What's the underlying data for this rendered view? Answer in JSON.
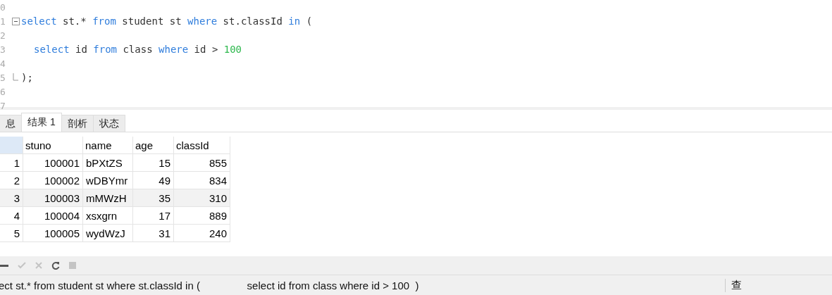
{
  "editor": {
    "lines": [
      {
        "number": "0",
        "kind": "plain"
      },
      {
        "number": "1",
        "kind": "fold_start",
        "tokens": [
          {
            "kind": "keyword",
            "text": "select"
          },
          {
            "kind": "plain",
            "text": " st.* "
          },
          {
            "kind": "keyword",
            "text": "from"
          },
          {
            "kind": "plain",
            "text": " student st "
          },
          {
            "kind": "keyword",
            "text": "where"
          },
          {
            "kind": "plain",
            "text": " st.classId "
          },
          {
            "kind": "keyword",
            "text": "in"
          },
          {
            "kind": "plain",
            "text": " ("
          }
        ]
      },
      {
        "number": "2",
        "kind": "plain"
      },
      {
        "number": "3",
        "kind": "indented",
        "tokens": [
          {
            "kind": "keyword",
            "text": "select"
          },
          {
            "kind": "plain",
            "text": " id "
          },
          {
            "kind": "keyword",
            "text": "from"
          },
          {
            "kind": "plain",
            "text": " class "
          },
          {
            "kind": "keyword",
            "text": "where"
          },
          {
            "kind": "plain",
            "text": " id > "
          },
          {
            "kind": "number",
            "text": "100"
          }
        ]
      },
      {
        "number": "4",
        "kind": "plain"
      },
      {
        "number": "5",
        "kind": "fold_end",
        "tokens": [
          {
            "kind": "plain",
            "text": ");"
          }
        ]
      },
      {
        "number": "6",
        "kind": "plain"
      },
      {
        "number": "7",
        "kind": "plain"
      }
    ]
  },
  "tabs": [
    {
      "label": "息",
      "selected": false
    },
    {
      "label": "结果 1",
      "selected": true
    },
    {
      "label": "剖析",
      "selected": false
    },
    {
      "label": "状态",
      "selected": false
    }
  ],
  "table": {
    "columns": [
      "stuno",
      "name",
      "age",
      "classId"
    ],
    "rows": [
      {
        "index": "1",
        "cells": [
          "100001",
          "bPXtZS",
          "15",
          "855"
        ],
        "selected": false
      },
      {
        "index": "2",
        "cells": [
          "100002",
          "wDBYmr",
          "49",
          "834"
        ],
        "selected": false
      },
      {
        "index": "3",
        "cells": [
          "100003",
          "mMWzH",
          "35",
          "310"
        ],
        "selected": true
      },
      {
        "index": "4",
        "cells": [
          "100004",
          "xsxgrn",
          "17",
          "889"
        ],
        "selected": false
      },
      {
        "index": "5",
        "cells": [
          "100005",
          "wydWzJ",
          "31",
          "240"
        ],
        "selected": false
      }
    ]
  },
  "toolbar": [
    {
      "kind": "minus",
      "disabled": false
    },
    {
      "kind": "check",
      "disabled": true
    },
    {
      "kind": "cross",
      "disabled": true
    },
    {
      "kind": "refresh",
      "disabled": false
    },
    {
      "kind": "stop",
      "disabled": true
    }
  ],
  "status_bar": {
    "query": "ect st.* from student st where st.classId in (                select id from class where id > 100  )",
    "right": "查"
  }
}
